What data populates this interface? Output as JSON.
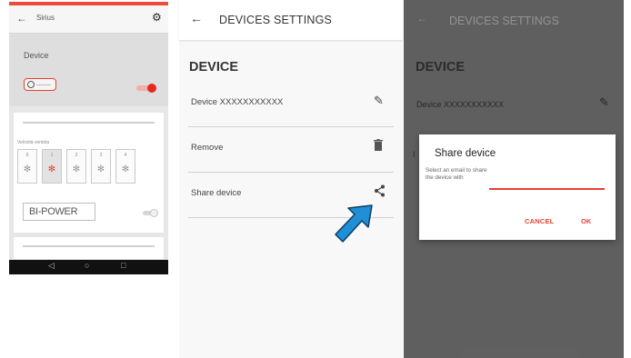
{
  "screen1": {
    "title": "Sirius",
    "back_icon": "arrow-left-icon",
    "settings_icon": "gear-icon",
    "device_label": "Device",
    "device_toggle": "on",
    "speed_label": "Velocità ventola",
    "speeds": [
      {
        "num": "0",
        "selected": false
      },
      {
        "num": "1",
        "selected": true
      },
      {
        "num": "2",
        "selected": false
      },
      {
        "num": "3",
        "selected": false
      },
      {
        "num": "4",
        "selected": false
      }
    ],
    "bipower_label": "BI-POWER",
    "bipower_toggle": "off",
    "nav_icons": [
      "back-triangle-icon",
      "home-circle-icon",
      "recents-square-icon"
    ]
  },
  "screen2": {
    "title": "DEVICES SETTINGS",
    "section": "DEVICE",
    "rows": [
      {
        "label": "Device XXXXXXXXXXX",
        "icon": "pencil-icon"
      },
      {
        "label": "Remove",
        "icon": "trash-icon"
      },
      {
        "label": "Share device",
        "icon": "share-icon"
      }
    ],
    "pointer_color": "#1f8fd6"
  },
  "screen3": {
    "title": "DEVICES SETTINGS",
    "section": "DEVICE",
    "device_row": "Device XXXXXXXXXXX",
    "row_stub": "I",
    "dialog": {
      "title": "Share device",
      "hint": "Select an email to share the device with",
      "cancel": "CANCEL",
      "ok": "OK"
    }
  },
  "colors": {
    "accent": "#e84033",
    "overlay": "#686868"
  }
}
